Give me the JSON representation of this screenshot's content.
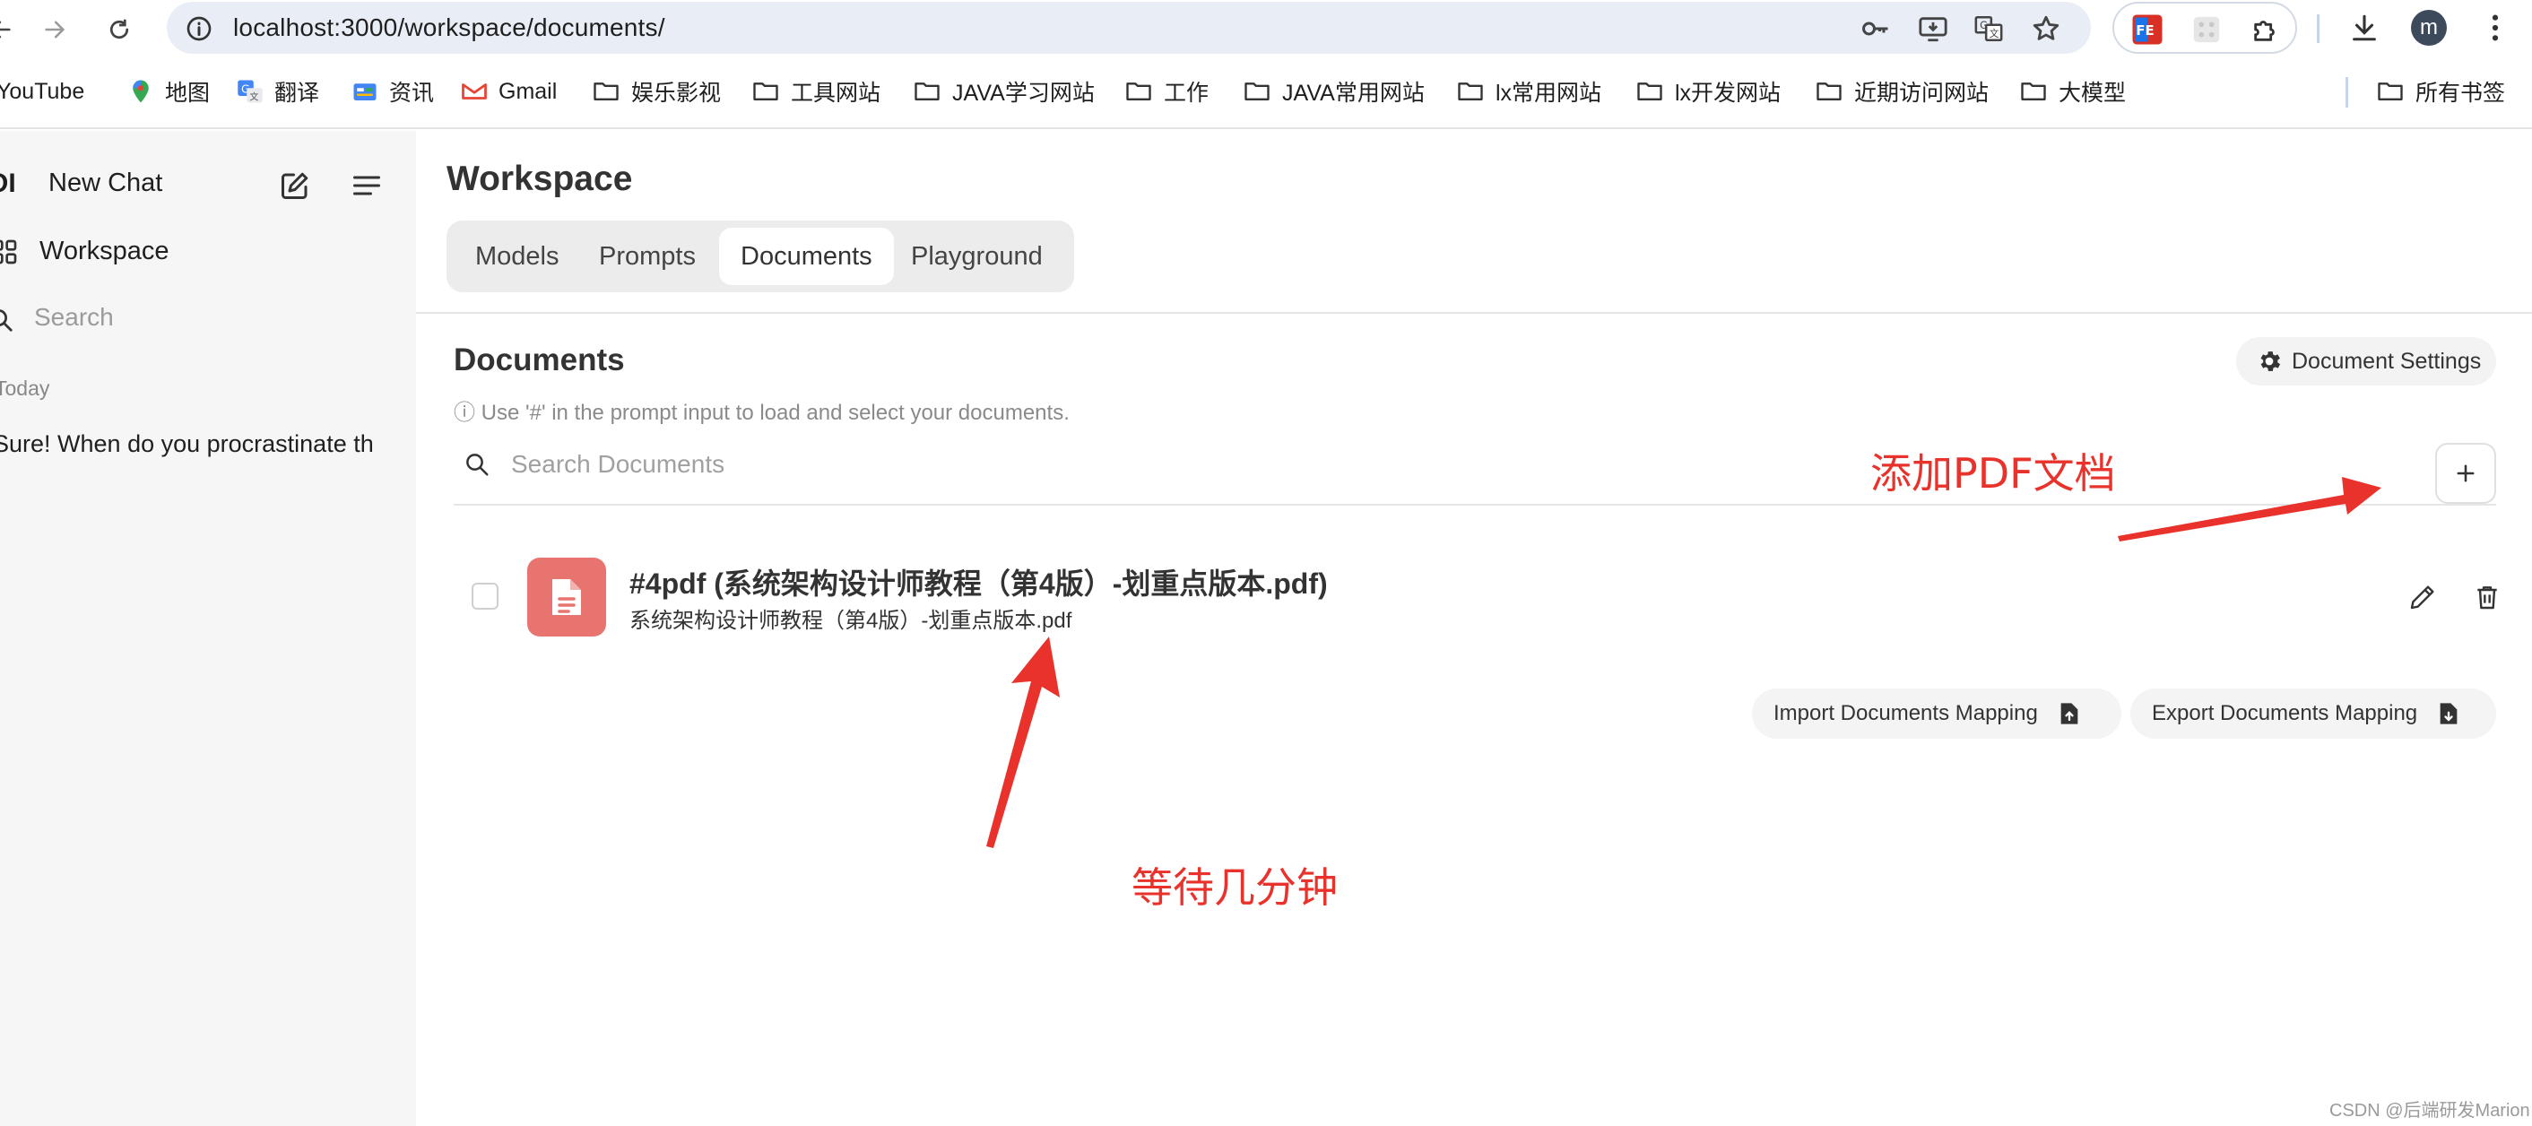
{
  "browser": {
    "url": "localhost:3000/workspace/documents/",
    "profile_initial": "m",
    "bookmarks": [
      {
        "label": "YouTube",
        "icon": "youtube-icon"
      },
      {
        "label": "地图",
        "icon": "maps-icon"
      },
      {
        "label": "翻译",
        "icon": "translate-icon"
      },
      {
        "label": "资讯",
        "icon": "news-icon"
      },
      {
        "label": "Gmail",
        "icon": "gmail-icon"
      },
      {
        "label": "娱乐影视",
        "icon": "folder-icon"
      },
      {
        "label": "工具网站",
        "icon": "folder-icon"
      },
      {
        "label": "JAVA学习网站",
        "icon": "folder-icon"
      },
      {
        "label": "工作",
        "icon": "folder-icon"
      },
      {
        "label": "JAVA常用网站",
        "icon": "folder-icon"
      },
      {
        "label": "lx常用网站",
        "icon": "folder-icon"
      },
      {
        "label": "lx开发网站",
        "icon": "folder-icon"
      },
      {
        "label": "近期访问网站",
        "icon": "folder-icon"
      },
      {
        "label": "大模型",
        "icon": "folder-icon"
      }
    ],
    "all_bookmarks_label": "所有书签"
  },
  "sidebar": {
    "logo": "OI",
    "new_chat": "New Chat",
    "workspace": "Workspace",
    "search_placeholder": "Search",
    "section_today": "Today",
    "chats": [
      "Sure! When do you procrastinate th"
    ]
  },
  "workspace": {
    "title": "Workspace",
    "tabs": [
      {
        "label": "Models",
        "active": false
      },
      {
        "label": "Prompts",
        "active": false
      },
      {
        "label": "Documents",
        "active": true
      },
      {
        "label": "Playground",
        "active": false
      }
    ]
  },
  "documents": {
    "heading": "Documents",
    "settings_button": "Document Settings",
    "hint": "ⓘ Use '#' in the prompt input to load and select your documents.",
    "search_placeholder": "Search Documents",
    "items": [
      {
        "name": "#4pdf (系统架构设计师教程（第4版）-划重点版本.pdf)",
        "filename": "系统架构设计师教程（第4版）-划重点版本.pdf"
      }
    ],
    "import_button": "Import Documents Mapping",
    "export_button": "Export Documents Mapping"
  },
  "annotations": {
    "add_pdf": "添加PDF文档",
    "wait": "等待几分钟",
    "color": "#e8322b"
  },
  "watermark": "CSDN @后端研发Marion",
  "colors": {
    "file_tile": "#e8746f",
    "sidebar_bg": "#f6f6f6",
    "omnibox_bg": "#e9eef6"
  }
}
